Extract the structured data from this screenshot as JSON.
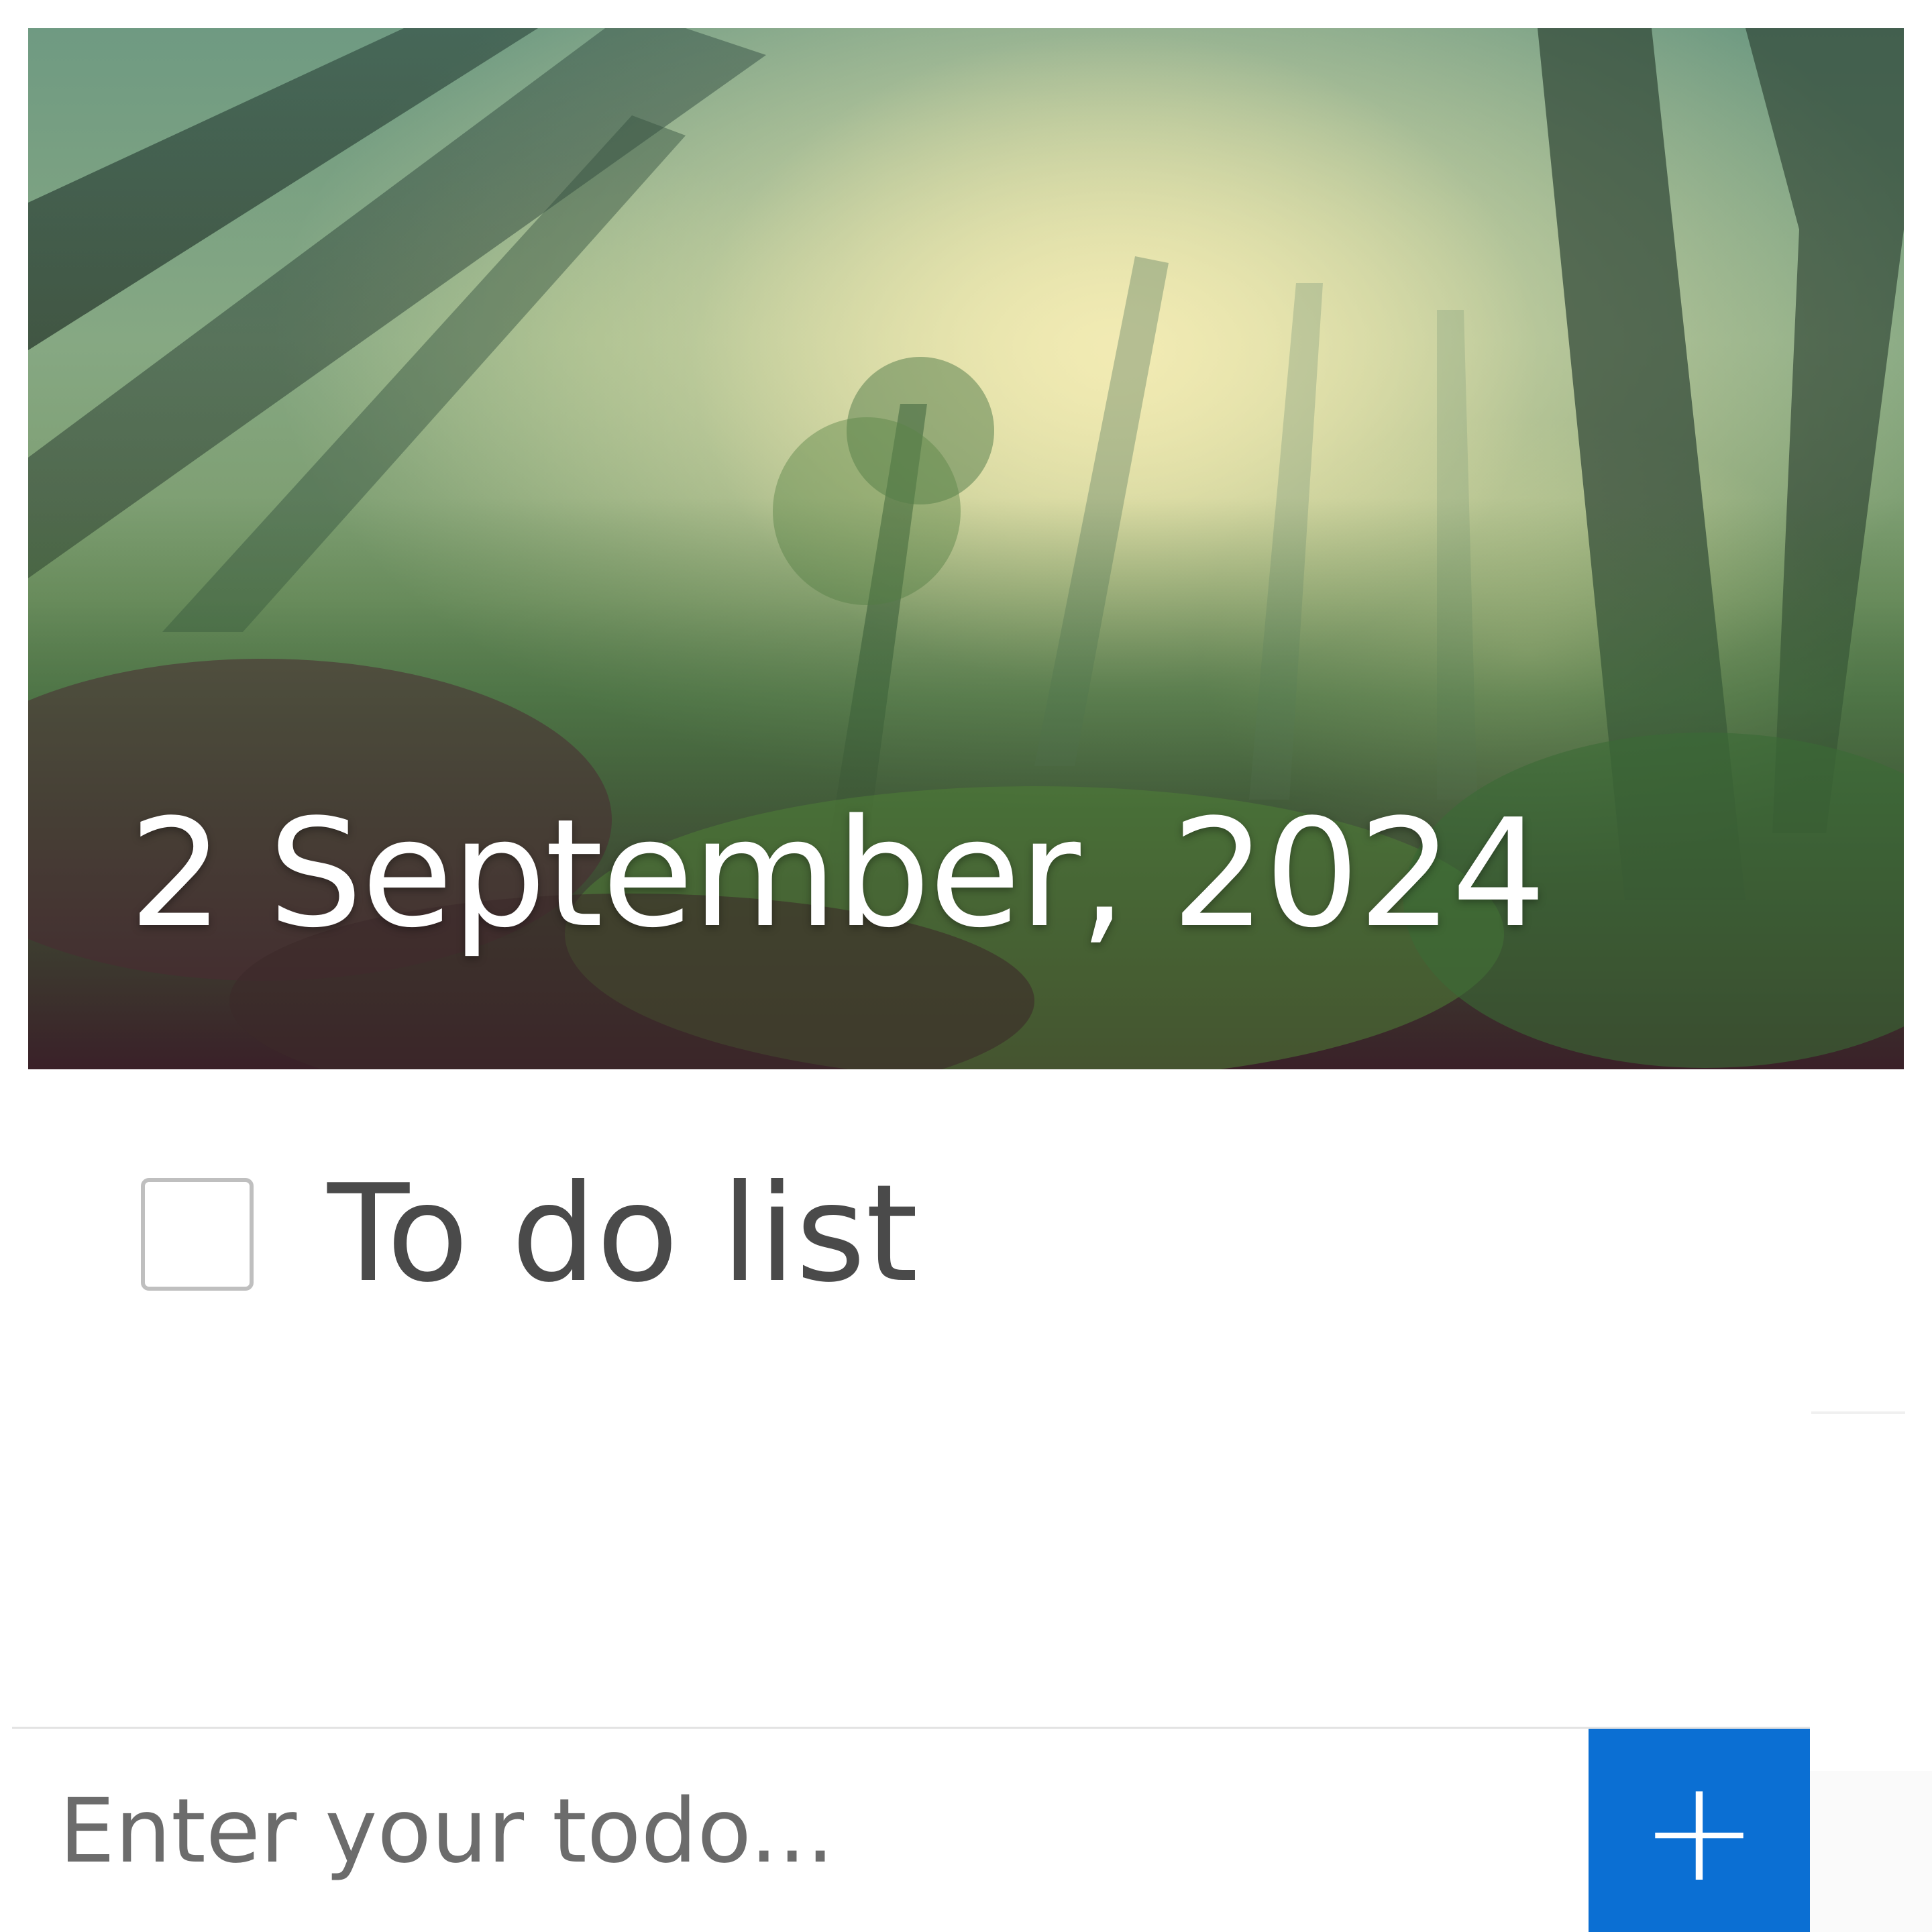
{
  "header": {
    "date": "2 September, 2024",
    "image": "forest-background"
  },
  "todos": [
    {
      "label": "To do list",
      "checked": false
    }
  ],
  "input": {
    "placeholder": "Enter your todo...",
    "value": ""
  },
  "add_button": {
    "icon": "plus-icon",
    "glyph": "+"
  },
  "colors": {
    "accent": "#0b6fd3",
    "date_text": "#ffffff",
    "todo_text": "#4a4a4a",
    "placeholder": "#6c6c6c"
  }
}
